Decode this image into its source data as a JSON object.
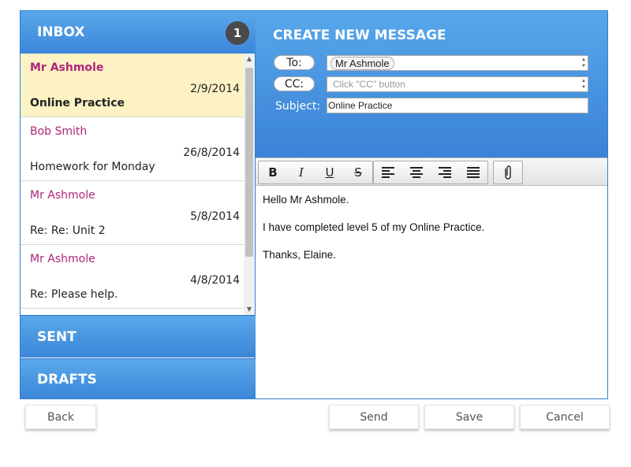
{
  "inbox": {
    "title": "INBOX",
    "unread_count": "1",
    "messages": [
      {
        "from": "Mr Ashmole",
        "date": "2/9/2014",
        "subject": "Online Practice"
      },
      {
        "from": "Bob Smith",
        "date": "26/8/2014",
        "subject": "Homework for Monday"
      },
      {
        "from": "Mr Ashmole",
        "date": "5/8/2014",
        "subject": "Re: Re: Unit 2"
      },
      {
        "from": "Mr Ashmole",
        "date": "4/8/2014",
        "subject": "Re: Please help."
      }
    ]
  },
  "folders": {
    "sent": "SENT",
    "drafts": "DRAFTS"
  },
  "compose": {
    "title": "CREATE NEW MESSAGE",
    "to_label": "To:",
    "to_value": "Mr Ashmole",
    "cc_label": "CC:",
    "cc_placeholder": "Click \"CC\" button",
    "subject_label": "Subject:",
    "subject_value": "Online Practice",
    "body": [
      "Hello Mr Ashmole.",
      "I have completed level 5 of my Online Practice.",
      "Thanks, Elaine."
    ]
  },
  "toolbar": {
    "bold": "B",
    "italic": "I",
    "underline": "U",
    "strike": "S"
  },
  "buttons": {
    "back": "Back",
    "send": "Send",
    "save": "Save",
    "cancel": "Cancel"
  },
  "colors": {
    "accent": "#3b86d8",
    "sender": "#b0247a",
    "selected_bg": "#fcf2c4"
  }
}
